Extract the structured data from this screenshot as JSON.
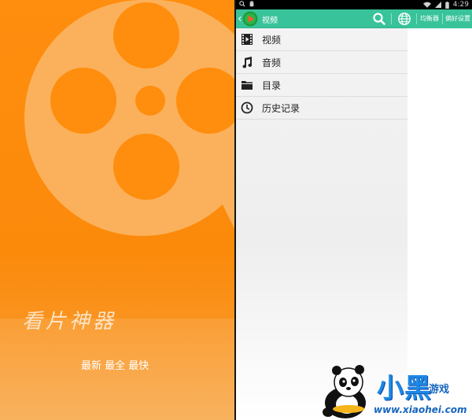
{
  "splash": {
    "title": "看片神器",
    "tagline": "最新 最全 最快",
    "colors": {
      "background": "#ff8d0e",
      "reel": "#fbb15b"
    }
  },
  "statusbar": {
    "left_icons": [
      "search-icon",
      "android-icon"
    ],
    "right_icons": [
      "wifi-icon",
      "signal-icon",
      "battery-icon"
    ],
    "time": "4:29"
  },
  "actionbar": {
    "title": "视频",
    "equalizer_label": "均衡器",
    "preferences_label": "偏好设置",
    "icons": [
      "back-chevron-icon",
      "play-logo-icon",
      "search-icon",
      "globe-icon"
    ],
    "color": "#39c39a"
  },
  "drawer": {
    "items": [
      {
        "label": "视频",
        "icon": "film-icon"
      },
      {
        "label": "音频",
        "icon": "music-note-icon"
      },
      {
        "label": "目录",
        "icon": "folder-icon"
      },
      {
        "label": "历史记录",
        "icon": "clock-icon"
      }
    ]
  },
  "watermark": {
    "brand": "小黑",
    "sub": "游戏",
    "url": "www.xiaohei.com"
  }
}
